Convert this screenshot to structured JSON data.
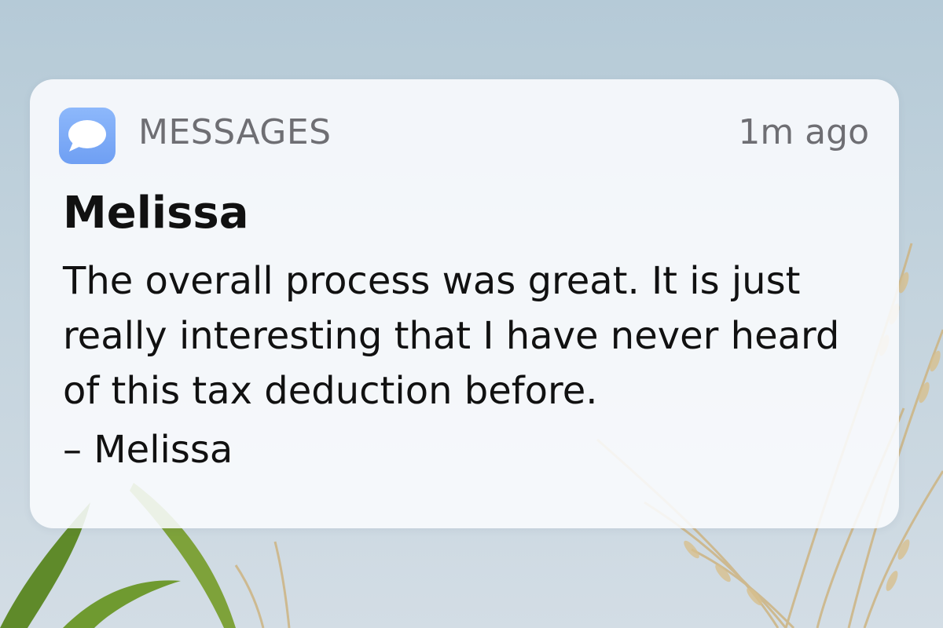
{
  "notification": {
    "app_icon": "messages-icon",
    "app_name": "MESSAGES",
    "timestamp": "1m ago",
    "sender": "Melissa",
    "body": "The overall process was great. It is just really interesting that I have never heard of this tax deduction before.",
    "signature": "– Melissa"
  },
  "colors": {
    "icon_blue": "#7aa8f7",
    "secondary_text": "#6e6e73",
    "primary_text": "#111111",
    "card_background": "#fafcfe"
  }
}
